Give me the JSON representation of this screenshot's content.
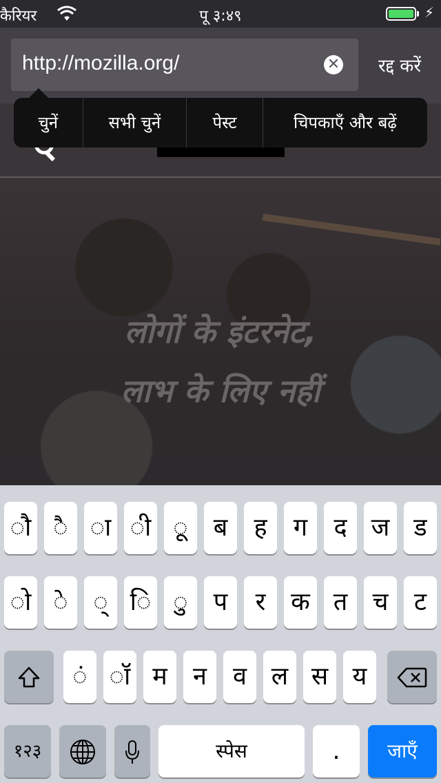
{
  "status_bar": {
    "carrier": "कैरियर",
    "time": "पू ३:४९",
    "battery_level": 1.0
  },
  "url_bar": {
    "url": "http://mozilla.org/",
    "cancel_label": "रद्द करें"
  },
  "context_menu": {
    "items": [
      "चुनें",
      "सभी चुनें",
      "पेस्ट",
      "चिपकाएँ और बढ़ें"
    ]
  },
  "page": {
    "headline_line1": "लोगों के इंटरनेट,",
    "headline_line2": "लाभ के लिए नहीं"
  },
  "keyboard": {
    "row1": [
      "ौ",
      "ै",
      "ा",
      "ी",
      "ू",
      "ब",
      "ह",
      "ग",
      "द",
      "ज",
      "ड"
    ],
    "row2": [
      "ो",
      "े",
      "्",
      "ि",
      "ु",
      "प",
      "र",
      "क",
      "त",
      "च",
      "ट"
    ],
    "row3": [
      "ं",
      "ॉ",
      "म",
      "न",
      "व",
      "ल",
      "स",
      "य"
    ],
    "numbers_label": "१२३",
    "space_label": "स्पेस",
    "period_label": ".",
    "go_label": "जाएँ"
  },
  "icons": {
    "wifi": "wifi-icon",
    "clear": "clear-icon",
    "shift": "shift-icon",
    "delete": "backspace-icon",
    "globe": "globe-icon",
    "mic": "microphone-icon"
  }
}
